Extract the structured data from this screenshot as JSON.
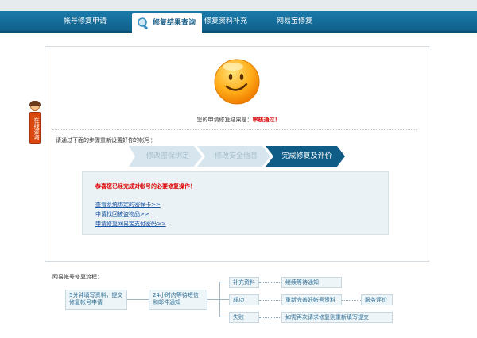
{
  "nav": {
    "items": [
      {
        "label": "帐号修复申请"
      },
      {
        "label": "修复结果查询"
      },
      {
        "label": "修复资料补充"
      },
      {
        "label": "网易宝修复"
      }
    ]
  },
  "side_tab": {
    "label": "在线咨询"
  },
  "result": {
    "prefix": "您的申请修复结果是：",
    "status": "审核通过！"
  },
  "steps": {
    "intro": "请通过下面的步骤重新设置好你的帐号：",
    "items": [
      {
        "label": "修改密保绑定",
        "state": "done"
      },
      {
        "label": "修改安全信息",
        "state": "done"
      },
      {
        "label": "完成修复及评价",
        "state": "current"
      }
    ]
  },
  "info": {
    "congrats": "恭喜您已经完成对帐号的必要修复操作！",
    "links": [
      {
        "label": "查看系统绑定的密保卡>>"
      },
      {
        "label": "申请找回被盗物品>>"
      },
      {
        "label": "申请修复网易宝支付密码>>"
      }
    ]
  },
  "flow": {
    "title": "网易帐号修复流程：",
    "start": "5分钟填写资料，提交修复帐号申请",
    "wait": "24小时内等待短信和邮件通知",
    "branches": [
      {
        "label": "补充资料",
        "next": "继续等待通知"
      },
      {
        "label": "成功",
        "next": "重新完善好帐号资料",
        "final": "服务评价"
      },
      {
        "label": "失败",
        "next": "如需再次请求修复则重新填写提交"
      }
    ]
  },
  "colors": {
    "nav_bg": "#1570a0",
    "status_red": "#d80000",
    "step_done": "#d7e6ee",
    "step_current": "#0f5d86",
    "link_blue": "#1a56a6"
  }
}
